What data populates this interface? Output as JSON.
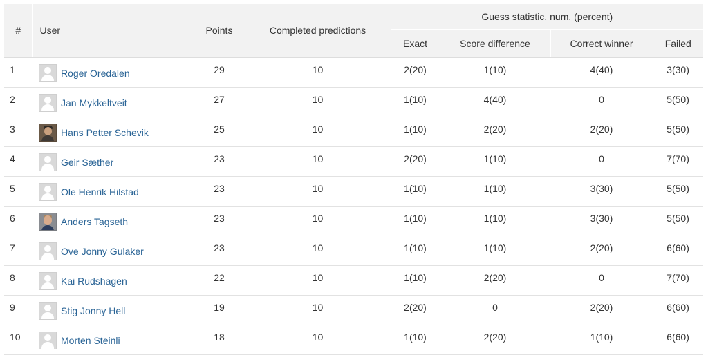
{
  "header": {
    "rank": "#",
    "user": "User",
    "points": "Points",
    "completed": "Completed predictions",
    "guess_group": "Guess statistic, num. (percent)",
    "exact": "Exact",
    "score_difference": "Score difference",
    "correct_winner": "Correct winner",
    "failed": "Failed"
  },
  "rows": [
    {
      "rank": "1",
      "user": "Roger Oredalen",
      "avatar": "default-avatar-icon",
      "points": "29",
      "completed": "10",
      "exact": "2(20)",
      "score_difference": "1(10)",
      "correct_winner": "4(40)",
      "failed": "3(30)"
    },
    {
      "rank": "2",
      "user": "Jan Mykkeltveit",
      "avatar": "default-avatar-icon",
      "points": "27",
      "completed": "10",
      "exact": "1(10)",
      "score_difference": "4(40)",
      "correct_winner": "0",
      "failed": "5(50)"
    },
    {
      "rank": "3",
      "user": "Hans Petter Schevik",
      "avatar": "photo-avatar-icon",
      "points": "25",
      "completed": "10",
      "exact": "1(10)",
      "score_difference": "2(20)",
      "correct_winner": "2(20)",
      "failed": "5(50)"
    },
    {
      "rank": "4",
      "user": "Geir Sæther",
      "avatar": "default-avatar-icon",
      "points": "23",
      "completed": "10",
      "exact": "2(20)",
      "score_difference": "1(10)",
      "correct_winner": "0",
      "failed": "7(70)"
    },
    {
      "rank": "5",
      "user": "Ole Henrik Hilstad",
      "avatar": "default-avatar-icon",
      "points": "23",
      "completed": "10",
      "exact": "1(10)",
      "score_difference": "1(10)",
      "correct_winner": "3(30)",
      "failed": "5(50)"
    },
    {
      "rank": "6",
      "user": "Anders Tagseth",
      "avatar": "photo-avatar-icon",
      "points": "23",
      "completed": "10",
      "exact": "1(10)",
      "score_difference": "1(10)",
      "correct_winner": "3(30)",
      "failed": "5(50)"
    },
    {
      "rank": "7",
      "user": "Ove Jonny Gulaker",
      "avatar": "default-avatar-icon",
      "points": "23",
      "completed": "10",
      "exact": "1(10)",
      "score_difference": "1(10)",
      "correct_winner": "2(20)",
      "failed": "6(60)"
    },
    {
      "rank": "8",
      "user": "Kai Rudshagen",
      "avatar": "default-avatar-icon",
      "points": "22",
      "completed": "10",
      "exact": "1(10)",
      "score_difference": "2(20)",
      "correct_winner": "0",
      "failed": "7(70)"
    },
    {
      "rank": "9",
      "user": "Stig Jonny Hell",
      "avatar": "default-avatar-icon",
      "points": "19",
      "completed": "10",
      "exact": "2(20)",
      "score_difference": "0",
      "correct_winner": "2(20)",
      "failed": "6(60)"
    },
    {
      "rank": "10",
      "user": "Morten Steinli",
      "avatar": "default-avatar-icon",
      "points": "18",
      "completed": "10",
      "exact": "1(10)",
      "score_difference": "2(20)",
      "correct_winner": "1(10)",
      "failed": "6(60)"
    }
  ],
  "colors": {
    "link": "#2a6496",
    "header_bg": "#f2f2f2",
    "row_border": "#e2e2e2"
  }
}
